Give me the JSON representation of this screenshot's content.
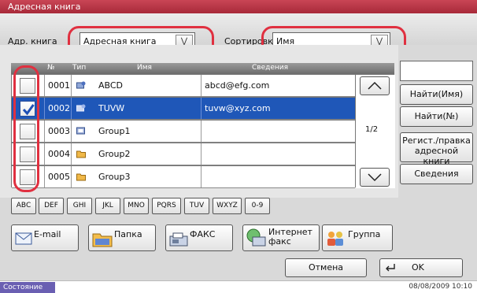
{
  "window": {
    "title": "Адресная книга"
  },
  "filter": {
    "book_label": "Адр. книга",
    "book_value": "Адресная книга",
    "sort_label": "Сортировка",
    "sort_value": "Имя"
  },
  "table": {
    "headers": {
      "no": "№",
      "type": "Тип",
      "name": "Имя",
      "details": "Сведения"
    },
    "rows": [
      {
        "no": "0001",
        "type": "email",
        "name": "ABCD",
        "details": "abcd@efg.com",
        "checked": false,
        "selected": false
      },
      {
        "no": "0002",
        "type": "email",
        "name": "TUVW",
        "details": "tuvw@xyz.com",
        "checked": true,
        "selected": true
      },
      {
        "no": "0003",
        "type": "group",
        "name": "Group1",
        "details": "",
        "checked": false,
        "selected": false
      },
      {
        "no": "0004",
        "type": "folder",
        "name": "Group2",
        "details": "",
        "checked": false,
        "selected": false
      },
      {
        "no": "0005",
        "type": "folder",
        "name": "Group3",
        "details": "",
        "checked": false,
        "selected": false
      }
    ]
  },
  "pagination": {
    "page": "1/2"
  },
  "right_buttons": {
    "find_name": "Найти(Имя)",
    "find_no": "Найти(№)",
    "register": "Регист./правка адресной книги",
    "details": "Сведения"
  },
  "letters": [
    "ABC",
    "DEF",
    "GHI",
    "JKL",
    "MNO",
    "PQRS",
    "TUV",
    "WXYZ",
    "0-9"
  ],
  "types": {
    "email": "E-mail",
    "folder": "Папка",
    "fax": "ФАКС",
    "ifax": "Интернет факс",
    "group": "Группа"
  },
  "footer": {
    "cancel": "Отмена",
    "ok": "OK"
  },
  "status": {
    "label": "Состояние",
    "datetime": "08/08/2009  10:10"
  },
  "colors": {
    "title": "#b43444",
    "selected_row": "#1f57b8",
    "ring": "#e03040",
    "status": "#6a5fb2"
  }
}
